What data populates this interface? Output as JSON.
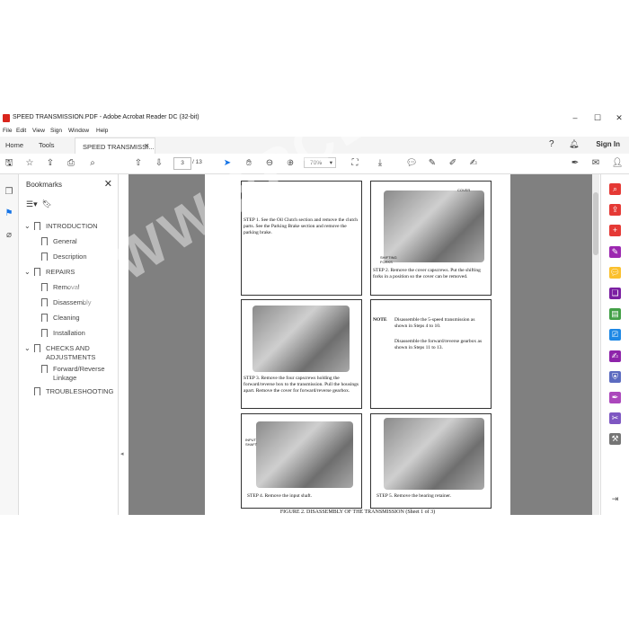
{
  "window": {
    "title": "SPEED TRANSMISSION.PDF - Adobe Acrobat Reader DC (32-bit)",
    "minimize": "–",
    "maximize": "☐",
    "close": "✕"
  },
  "menu": [
    "File",
    "Edit",
    "View",
    "Sign",
    "Window",
    "Help"
  ],
  "tabs": {
    "home": "Home",
    "tools": "Tools",
    "document": "SPEED TRANSMISSI...",
    "document_close": "×",
    "sign_in": "Sign In"
  },
  "toolbar": {
    "current_page": "3",
    "total_pages": "/ 13",
    "zoom": "70%"
  },
  "bookmarks": {
    "header": "Bookmarks",
    "items": [
      {
        "label": "INTRODUCTION",
        "level": 0,
        "expanded": true
      },
      {
        "label": "General",
        "level": 1
      },
      {
        "label": "Description",
        "level": 1
      },
      {
        "label": "REPAIRS",
        "level": 0,
        "expanded": true
      },
      {
        "label": "Removal",
        "level": 1
      },
      {
        "label": "Disassembly",
        "level": 1
      },
      {
        "label": "Cleaning",
        "level": 1
      },
      {
        "label": "Installation",
        "level": 1
      },
      {
        "label": "CHECKS AND ADJUSTMENTS",
        "level": 0,
        "expanded": true
      },
      {
        "label": "Forward/Reverse Linkage",
        "level": 1
      },
      {
        "label": "TROUBLESHOOTING",
        "level": 0
      }
    ]
  },
  "document": {
    "step1": "STEP 1.  See the Oil Clutch section and remove the clutch parts. See the Parking Brake section and remove the parking brake.",
    "step2": "STEP 2.  Remove the cover capscrews. Put the shifting forks in a position so the cover can be removed.",
    "step2_label_cover": "COVER",
    "step2_label_forks": "SHIFTING FORKS",
    "step3": "STEP 3.  Remove the four capscrews holding the forward/reverse box to the transmission. Pull the housings apart. Remove the cover for forward/reverse gearbox.",
    "note_label": "NOTE",
    "note1": "Disassemble the 5-speed transmission as shown in Steps 4 to 10.",
    "note2": "Disassemble the forward/reverse gearbox as shown in Steps 11 to 13.",
    "step4": "STEP 4. Remove the input shaft.",
    "step4_label": "INPUT SHAFT",
    "step5": "STEP 5. Remove the bearing retainer.",
    "figure_caption": "FIGURE 2. DISASSEMBLY OF THE TRANSMISSION (Sheet 1 of 3)"
  },
  "watermark": "WWW.EPCDEPOT.COM",
  "colors": {
    "pdf_icon": "#d9251c",
    "viewer_bg": "#808080",
    "accent_blue": "#1473e6"
  }
}
